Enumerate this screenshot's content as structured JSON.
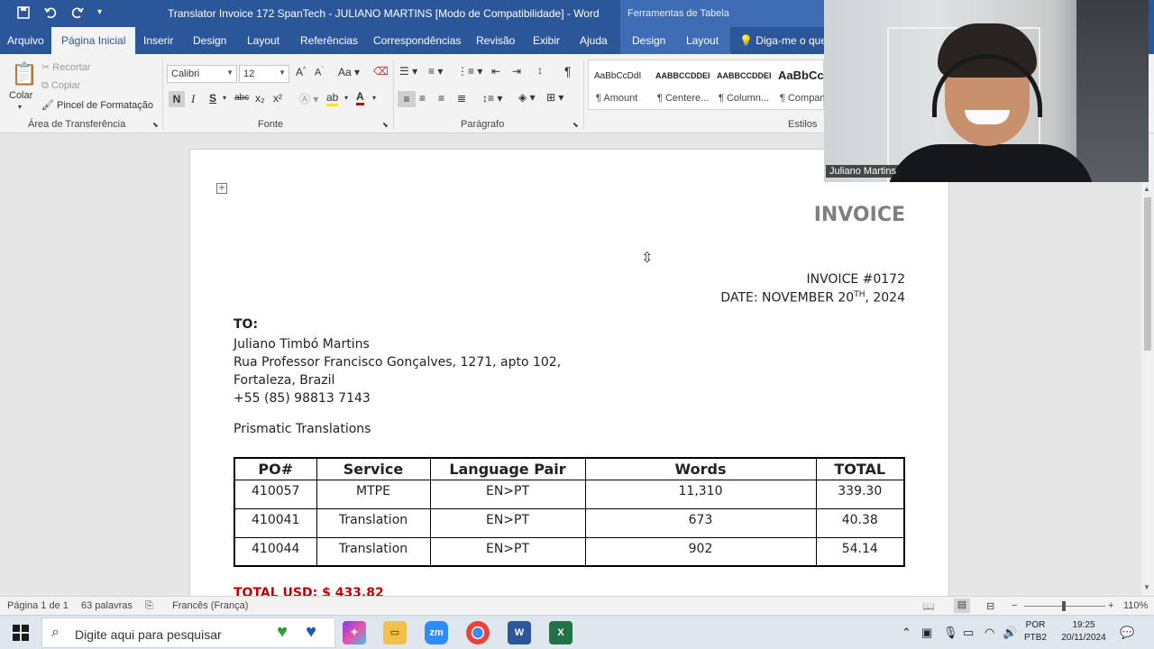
{
  "titlebar": {
    "title": "Translator Invoice 172 SpanTech - JULIANO MARTINS [Modo de Compatibilidade]  -  Word",
    "context_tools": "Ferramentas de Tabela"
  },
  "tabs": [
    "Arquivo",
    "Página Inicial",
    "Inserir",
    "Design",
    "Layout",
    "Referências",
    "Correspondências",
    "Revisão",
    "Exibir",
    "Ajuda",
    "Design",
    "Layout"
  ],
  "tell_me": "Diga-me o que",
  "ribbon": {
    "clipboard": {
      "paste": "Colar",
      "cut": "Recortar",
      "copy": "Copiar",
      "format_painter": "Pincel de Formatação",
      "label": "Área de Transferência"
    },
    "font": {
      "name": "Calibri",
      "size": "12",
      "bold": "N",
      "italic": "I",
      "underline": "S",
      "strike": "abc",
      "sub": "x₂",
      "sup": "x²",
      "label": "Fonte"
    },
    "paragraph": {
      "label": "Parágrafo"
    },
    "styles": {
      "label": "Estilos",
      "items": [
        {
          "sample": "AaBbCcDdI",
          "name": "¶ Amount"
        },
        {
          "sample": "AABBCCDDEI",
          "name": "¶ Centere..."
        },
        {
          "sample": "AABBCCDDEI",
          "name": "¶ Column..."
        },
        {
          "sample": "AaBbCcD",
          "name": "¶ Compan..."
        }
      ]
    }
  },
  "webcam": {
    "participant": "Juliano Martins"
  },
  "document": {
    "title": "INVOICE",
    "invoice_number": "INVOICE #0172",
    "date_prefix": "DATE: NOVEMBER 20",
    "date_sup": "TH",
    "date_suffix": ", 2024",
    "to_label": "TO:",
    "address": [
      "Juliano Timbó Martins",
      "Rua Professor Francisco Gonçalves, 1271, apto 102,",
      "Fortaleza, Brazil",
      "+55 (85) 98813 7143"
    ],
    "company": "Prismatic Translations",
    "table": {
      "headers": [
        "PO#",
        "Service",
        "Language Pair",
        "Words",
        "TOTAL"
      ],
      "rows": [
        [
          "410057",
          "MTPE",
          "EN>PT",
          "11,310",
          "339.30"
        ],
        [
          "410041",
          "Translation",
          "EN>PT",
          "673",
          "40.38"
        ],
        [
          "410044",
          "Translation",
          "EN>PT",
          "902",
          "54.14"
        ]
      ]
    },
    "total": "TOTAL USD: $ 433.82"
  },
  "statusbar": {
    "page": "Página 1 de 1",
    "words": "63 palavras",
    "language": "Francês (França)",
    "zoom": "110%"
  },
  "taskbar": {
    "search_placeholder": "Digite aqui para pesquisar",
    "lang_top": "POR",
    "lang_bottom": "PTB2",
    "time": "19:25",
    "date": "20/11/2024",
    "zoom_app": "zm"
  },
  "colors": {
    "word_blue": "#2b579a",
    "total_red": "#c00000",
    "invoice_gray": "#7f7f7f"
  }
}
